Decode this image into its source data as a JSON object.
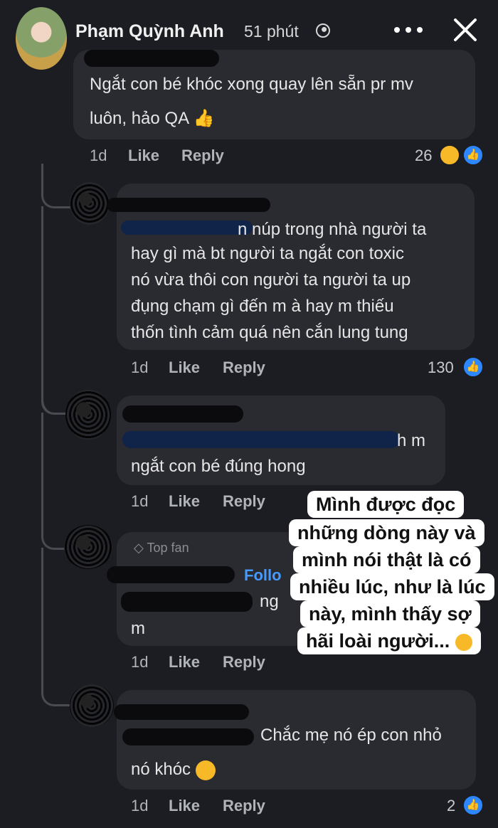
{
  "header": {
    "name": "Phạm Quỳnh Anh",
    "time": "51 phút",
    "more_icon": "more-dots-icon",
    "close_icon": "close-icon"
  },
  "comments": [
    {
      "text_line1": "Ngắt con bé khóc xong quay lên sẵn pr mv",
      "text_line2": "luôn, hảo QA",
      "time": "1d",
      "like": "Like",
      "reply": "Reply",
      "count": "26"
    },
    {
      "line1_visible": "n núp trong nhà người ta",
      "line2": "hay gì mà bt người ta ngắt con toxic",
      "line3": "nó vừa thôi con người ta người ta up",
      "line4": "đụng chạm gì đến m à hay m thiếu",
      "line5": "thốn tình cảm quá nên cắn lung tung",
      "time": "1d",
      "like": "Like",
      "reply": "Reply",
      "count": "130"
    },
    {
      "line1_visible": "h m",
      "line2": "ngắt con bé đúng hong",
      "time": "1d",
      "like": "Like",
      "reply": "Reply"
    },
    {
      "badge": "Top fan",
      "follow": "Follo",
      "line1_visible": "ng",
      "line2": "m",
      "time": "1d",
      "like": "Like",
      "reply": "Reply"
    },
    {
      "line1_visible": "Chắc mẹ nó ép con nhỏ",
      "line2": "nó khóc",
      "time": "1d",
      "like": "Like",
      "reply": "Reply",
      "count": "2"
    }
  ],
  "story_caption": {
    "line1": "Mình được đọc",
    "line2": "những dòng này và",
    "line3": "mình nói thật là có",
    "line4": "nhiều lúc, như là lúc",
    "line5": "này, mình thấy sợ",
    "line6": "hãi loài người..."
  },
  "colors": {
    "background": "#1c1d22",
    "bubble": "#2a2b30",
    "like_blue": "#2d88ff"
  }
}
